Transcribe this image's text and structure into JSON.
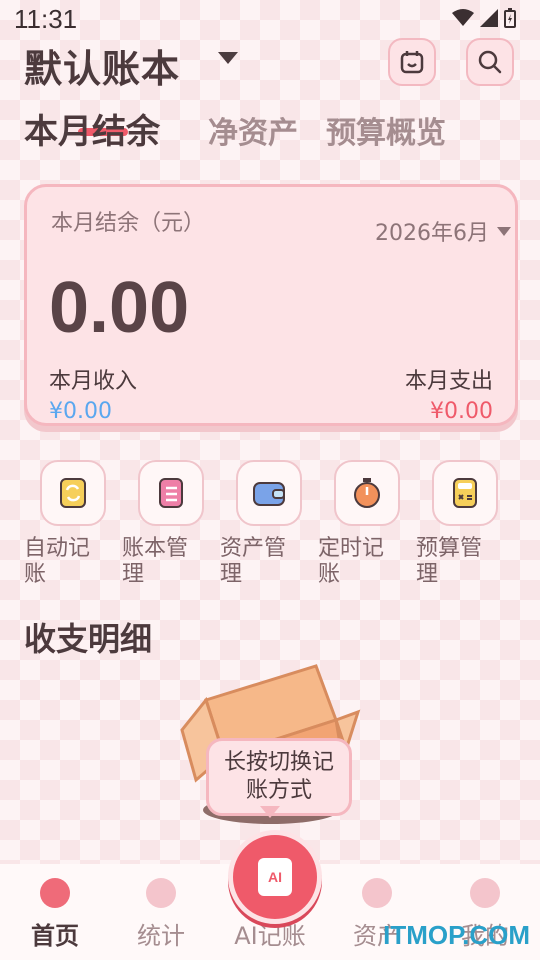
{
  "status_bar": {
    "time": "11:31"
  },
  "header": {
    "book_name": "默认账本"
  },
  "tabs": [
    {
      "label": "本月结余"
    },
    {
      "label": "净资产"
    },
    {
      "label": "预算概览"
    }
  ],
  "summary": {
    "label": "本月结余（元）",
    "month": "2026年6月",
    "balance": "0.00",
    "income_label": "本月收入",
    "income_value": "¥0.00",
    "expense_label": "本月支出",
    "expense_value": "¥0.00"
  },
  "actions": [
    {
      "label": "自动记账"
    },
    {
      "label": "账本管理"
    },
    {
      "label": "资产管理"
    },
    {
      "label": "定时记账"
    },
    {
      "label": "预算管理"
    }
  ],
  "details": {
    "title": "收支明细",
    "empty_tip": "长按切换记账方式"
  },
  "bottom_nav": [
    {
      "label": "首页"
    },
    {
      "label": "统计"
    },
    {
      "label": "AI记账"
    },
    {
      "label": "资产"
    },
    {
      "label": "我的"
    }
  ],
  "ai_button": {
    "text": "AI"
  },
  "watermark": "ITMOP.COM"
}
